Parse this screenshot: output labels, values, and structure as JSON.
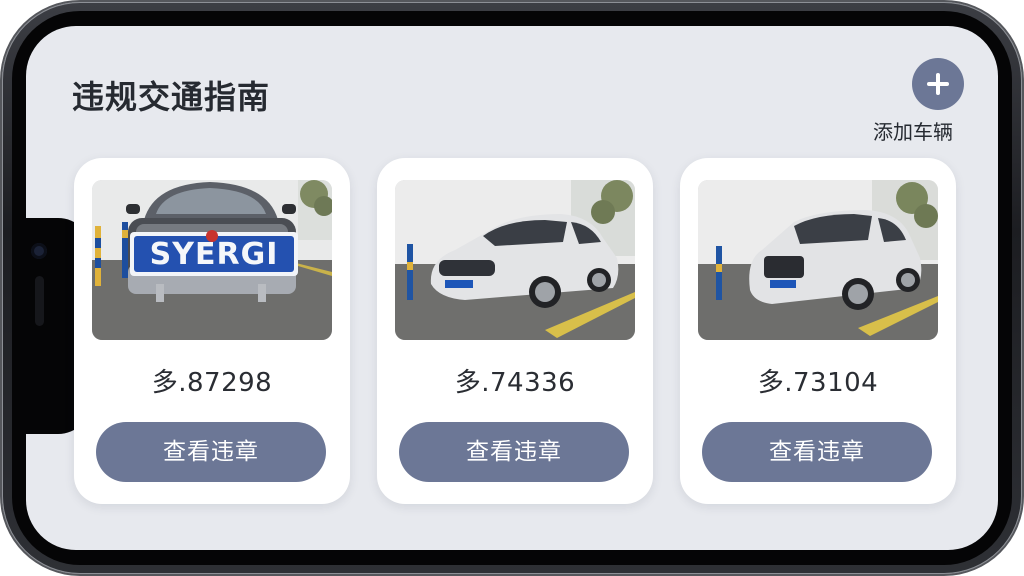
{
  "page": {
    "title": "违规交通指南"
  },
  "header": {
    "add_vehicle": {
      "icon": "plus-icon",
      "label": "添加车辆"
    }
  },
  "vehicles": [
    {
      "plate": "多.87298",
      "photo_plate_text": "SYERGI",
      "button_label": "查看违章"
    },
    {
      "plate": "多.74336",
      "button_label": "查看违章"
    },
    {
      "plate": "多.73104",
      "button_label": "查看违章"
    }
  ],
  "colors": {
    "screen_background": "#e7e9ee",
    "card_background": "#ffffff",
    "accent_button": "#6c7796",
    "text_primary": "#262a31"
  }
}
